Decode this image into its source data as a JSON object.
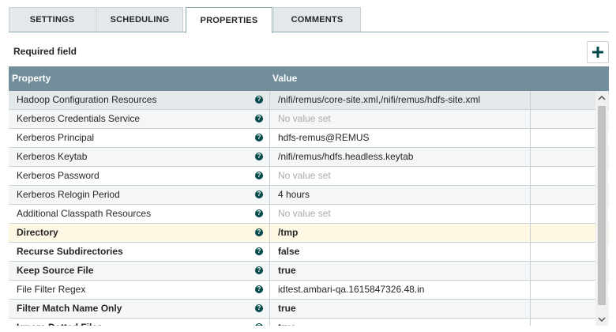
{
  "tabs": [
    {
      "label": "SETTINGS",
      "active": false
    },
    {
      "label": "SCHEDULING",
      "active": false
    },
    {
      "label": "PROPERTIES",
      "active": true
    },
    {
      "label": "COMMENTS",
      "active": false
    }
  ],
  "required_label": "Required field",
  "add_icon": "plus-icon",
  "table": {
    "headers": {
      "property": "Property",
      "value": "Value"
    },
    "rows": [
      {
        "name": "Hadoop Configuration Resources",
        "value": "/nifi/remus/core-site.xml,/nifi/remus/hdfs-site.xml",
        "required": false,
        "unset": false,
        "state": "selected"
      },
      {
        "name": "Kerberos Credentials Service",
        "value": "No value set",
        "required": false,
        "unset": true,
        "state": "alt"
      },
      {
        "name": "Kerberos Principal",
        "value": "hdfs-remus@REMUS",
        "required": false,
        "unset": false,
        "state": ""
      },
      {
        "name": "Kerberos Keytab",
        "value": "/nifi/remus/hdfs.headless.keytab",
        "required": false,
        "unset": false,
        "state": "alt"
      },
      {
        "name": "Kerberos Password",
        "value": "No value set",
        "required": false,
        "unset": true,
        "state": ""
      },
      {
        "name": "Kerberos Relogin Period",
        "value": "4 hours",
        "required": false,
        "unset": false,
        "state": "alt"
      },
      {
        "name": "Additional Classpath Resources",
        "value": "No value set",
        "required": false,
        "unset": true,
        "state": ""
      },
      {
        "name": "Directory",
        "value": "/tmp",
        "required": true,
        "unset": false,
        "state": "highlight"
      },
      {
        "name": "Recurse Subdirectories",
        "value": "false",
        "required": true,
        "unset": false,
        "state": ""
      },
      {
        "name": "Keep Source File",
        "value": "true",
        "required": true,
        "unset": false,
        "state": "alt"
      },
      {
        "name": "File Filter Regex",
        "value": "idtest.ambari-qa.1615847326.48.in",
        "required": false,
        "unset": false,
        "state": ""
      },
      {
        "name": "Filter Match Name Only",
        "value": "true",
        "required": true,
        "unset": false,
        "state": "alt"
      },
      {
        "name": "Ignore Dotted Files",
        "value": "true",
        "required": true,
        "unset": false,
        "state": ""
      }
    ]
  },
  "colors": {
    "header": "#728e9b",
    "help_icon": "#004849",
    "highlight_row": "#fdf7e3"
  },
  "help_glyph": "?"
}
